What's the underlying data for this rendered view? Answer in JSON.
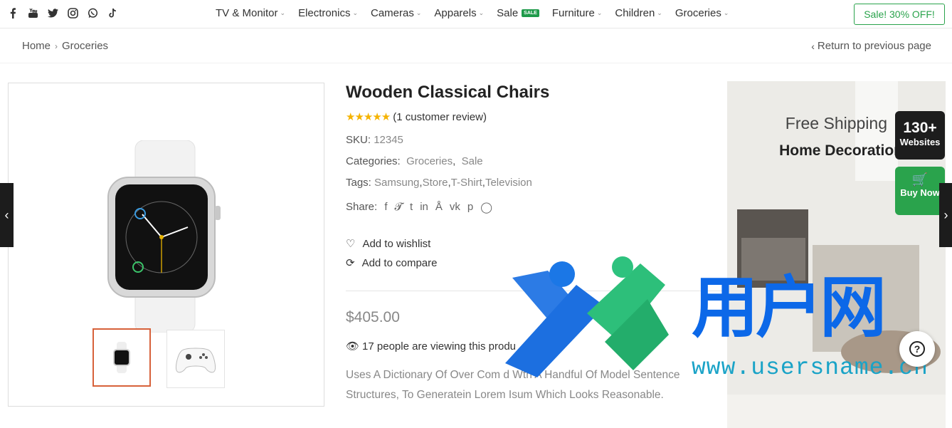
{
  "social": [
    "facebook-icon",
    "youtube-icon",
    "twitter-icon",
    "instagram-icon",
    "whatsapp-icon",
    "tiktok-icon"
  ],
  "nav": {
    "items": [
      {
        "label": "TV & Monitor",
        "dropdown": true
      },
      {
        "label": "Electronics",
        "dropdown": true
      },
      {
        "label": "Cameras",
        "dropdown": true
      },
      {
        "label": "Apparels",
        "dropdown": true
      },
      {
        "label": "Sale",
        "badge": "SALE",
        "dropdown": false
      },
      {
        "label": "Furniture",
        "dropdown": true
      },
      {
        "label": "Children",
        "dropdown": true
      },
      {
        "label": "Groceries",
        "dropdown": true
      }
    ],
    "sale_button": "Sale! 30% OFF!"
  },
  "breadcrumb": {
    "home": "Home",
    "current": "Groceries",
    "return_label": "Return to previous page"
  },
  "product": {
    "title": "Wooden Classical Chairs",
    "rating": 5,
    "review_text": "(1 customer review)",
    "sku_label": "SKU:",
    "sku": "12345",
    "categories_label": "Categories:",
    "categories": [
      "Groceries",
      "Sale"
    ],
    "tags_label": "Tags:",
    "tags": [
      "Samsung",
      "Store",
      "T-Shirt",
      "Television"
    ],
    "share_label": "Share:",
    "share_icons": [
      "facebook-icon",
      "twitter-icon",
      "tumblr-icon",
      "linkedin-icon",
      "stumbleupon-icon",
      "vk-icon",
      "pinterest-icon",
      "whatsapp-icon"
    ],
    "wishlist": "Add to wishlist",
    "compare": "Add to compare",
    "price": "$405.00",
    "viewing": "17 people are viewing this produ",
    "description": "Uses A Dictionary Of Over Com    d Wth A Handful Of Model Sentence Structures, To Generatein Lorem Isum Which Looks Reasonable."
  },
  "promo": {
    "line1": "Free Shipping",
    "line2": "Home Decoration"
  },
  "side_badges": {
    "websites_count": "130+",
    "websites_label": "Websites",
    "buy_label": "Buy Now"
  },
  "watermark": {
    "cn": "用户网",
    "url": "www.usersname.cn"
  },
  "colors": {
    "accent_green": "#2aa34c",
    "thumb_active": "#d7613a",
    "star": "#f5b301",
    "watermark_blue": "#0c68e8"
  }
}
